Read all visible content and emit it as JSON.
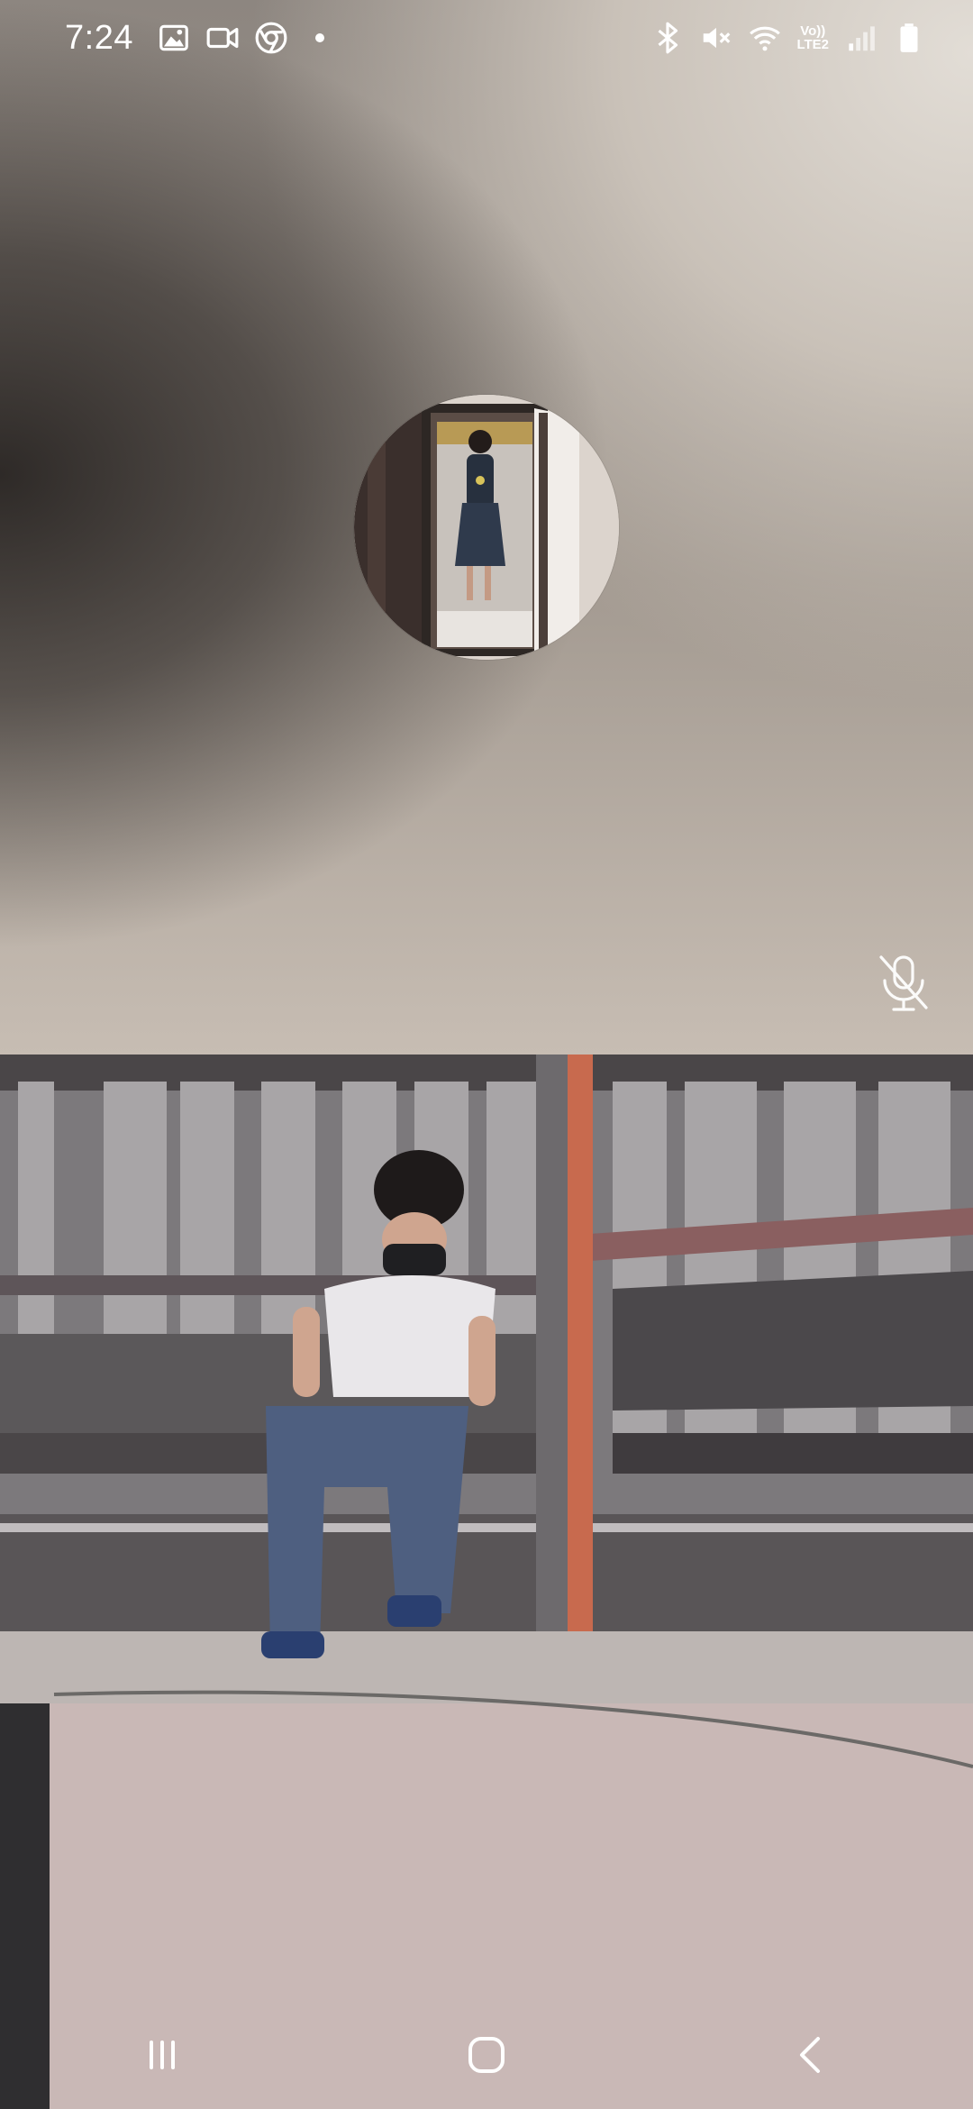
{
  "status_bar": {
    "time": "7:24",
    "left_icons": [
      "gallery-icon",
      "video-camera-icon",
      "chrome-icon",
      "notification-dot"
    ],
    "right_icons": [
      "bluetooth-icon",
      "vibrate-mute-icon",
      "wifi-icon",
      "volte-lte2-icon",
      "signal-icon",
      "battery-icon"
    ],
    "network_label_top": "Vo))",
    "network_label_bottom": "LTE2"
  },
  "remote_participant": {
    "avatar": "participant-photo",
    "mic_muted": true,
    "mic_icon": "mic-off-icon"
  },
  "local_video": {
    "content": "camera-preview"
  },
  "nav_bar": {
    "buttons": [
      "recent-apps-icon",
      "home-icon",
      "back-icon"
    ]
  },
  "colors": {
    "icon": "#ffffff",
    "top_bg_dark": "#3f3a37",
    "top_bg_light": "#e2ddd6"
  }
}
